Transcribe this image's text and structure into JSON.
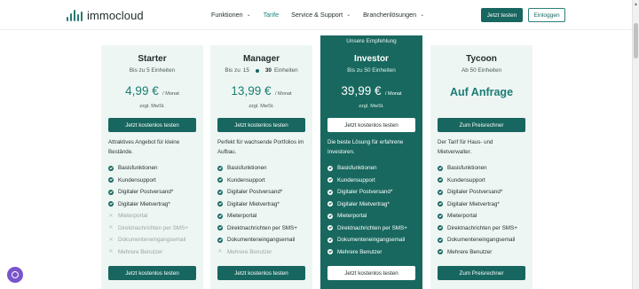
{
  "brand": {
    "name": "immocloud"
  },
  "nav": {
    "items": [
      {
        "label": "Funktionen",
        "has_menu": true,
        "active": false
      },
      {
        "label": "Tarife",
        "has_menu": false,
        "active": true
      },
      {
        "label": "Service & Support",
        "has_menu": true,
        "active": false
      },
      {
        "label": "Branchenlösungen",
        "has_menu": true,
        "active": false
      }
    ],
    "try_label": "Jetzt testen",
    "login_label": "Einloggen"
  },
  "colors": {
    "accent": "#17665f",
    "featured_bg": "#18685f",
    "card_bg": "#eef6f4",
    "price": "#1a7d73"
  },
  "plans": [
    {
      "name": "Starter",
      "units": "Bis zu 5 Einheiten",
      "price": "4,99 €",
      "per": "/ Monat",
      "tax": "zzgl. MwSt.",
      "cta_top": "Jetzt kostenlos testen",
      "desc": "Attraktives Angebot für kleine Bestände.",
      "features": [
        {
          "label": "Basisfunktionen",
          "included": true
        },
        {
          "label": "Kundensupport",
          "included": true
        },
        {
          "label": "Digitaler Postversand*",
          "included": true
        },
        {
          "label": "Digitaler Mietvertrag*",
          "included": true
        },
        {
          "label": "Mieterportal",
          "included": false
        },
        {
          "label": "Direktnachrichten per SMS+",
          "included": false
        },
        {
          "label": "Dokumenteneingangsemail",
          "included": false
        },
        {
          "label": "Mehrere Benutzer",
          "included": false
        }
      ],
      "cta_bottom": "Jetzt kostenlos testen"
    },
    {
      "name": "Manager",
      "units_from": "Bis zu",
      "units_low": "15",
      "units_high": "30",
      "units_suffix": "Einheiten",
      "price": "13,99 €",
      "per": "/ Monat",
      "tax": "zzgl. MwSt.",
      "cta_top": "Jetzt kostenlos testen",
      "desc": "Perfekt für wachsende Portfolios im Aufbau.",
      "features": [
        {
          "label": "Basisfunktionen",
          "included": true
        },
        {
          "label": "Kundensupport",
          "included": true
        },
        {
          "label": "Digitaler Postversand*",
          "included": true
        },
        {
          "label": "Digitaler Mietvertrag*",
          "included": true
        },
        {
          "label": "Mieterportal",
          "included": true
        },
        {
          "label": "Direktnachrichten per SMS+",
          "included": true
        },
        {
          "label": "Dokumenteneingangsemail",
          "included": true
        },
        {
          "label": "Mehrere Benutzer",
          "included": false
        }
      ],
      "cta_bottom": "Jetzt kostenlos testen"
    },
    {
      "name": "Investor",
      "badge": "Unsere Empfehlung",
      "units": "Bis zu 50 Einheiten",
      "price": "39,99 €",
      "per": "/ Monat",
      "tax": "zzgl. MwSt.",
      "cta_top": "Jetzt kostenlos testen",
      "desc": "Die beste Lösung für erfahrene Investoren.",
      "features": [
        {
          "label": "Basisfunktionen",
          "included": true
        },
        {
          "label": "Kundensupport",
          "included": true
        },
        {
          "label": "Digitaler Postversand*",
          "included": true
        },
        {
          "label": "Digitaler Mietvertrag*",
          "included": true
        },
        {
          "label": "Mieterportal",
          "included": true
        },
        {
          "label": "Direktnachrichten per SMS+",
          "included": true
        },
        {
          "label": "Dokumenteneingangsemail",
          "included": true
        },
        {
          "label": "Mehrere Benutzer",
          "included": true
        }
      ],
      "cta_bottom": "Jetzt kostenlos testen"
    },
    {
      "name": "Tycoon",
      "units": "Ab 50 Einheiten",
      "price": "Auf Anfrage",
      "cta_top": "Zum Preisrechner",
      "desc": "Der Tarif für Haus- und Mietverwalter.",
      "features": [
        {
          "label": "Basisfunktionen",
          "included": true
        },
        {
          "label": "Kundensupport",
          "included": true
        },
        {
          "label": "Digitaler Postversand*",
          "included": true
        },
        {
          "label": "Digitaler Mietvertrag*",
          "included": true
        },
        {
          "label": "Mieterportal",
          "included": true
        },
        {
          "label": "Direktnachrichten per SMS+",
          "included": true
        },
        {
          "label": "Dokumenteneingangsemail",
          "included": true
        },
        {
          "label": "Mehrere Benutzer",
          "included": true
        }
      ],
      "cta_bottom": "Zum Preisrechner"
    }
  ]
}
